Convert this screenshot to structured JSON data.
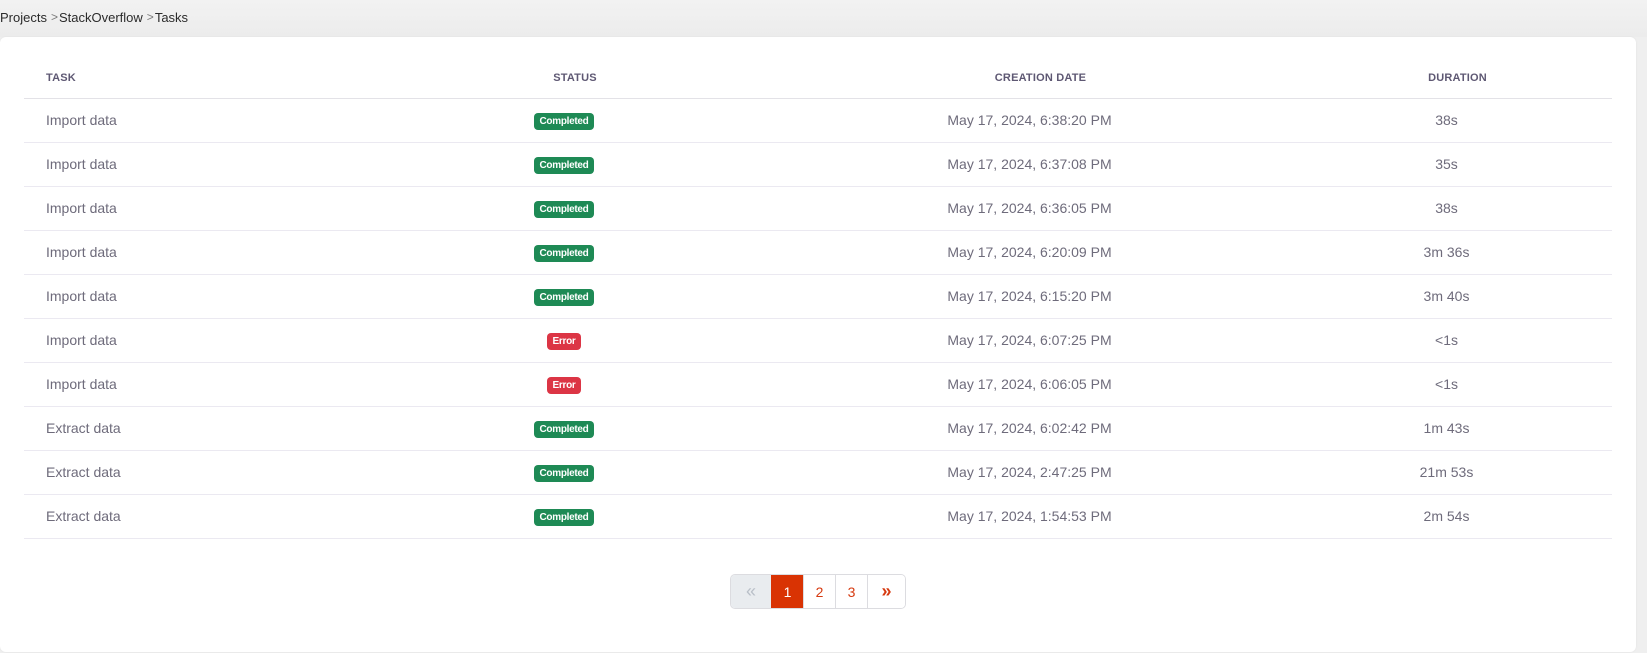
{
  "breadcrumb": {
    "items": [
      "Projects",
      "StackOverflow",
      "Tasks"
    ],
    "separator": ">"
  },
  "table": {
    "headers": {
      "task": "TASK",
      "status": "STATUS",
      "creation_date": "CREATION DATE",
      "duration": "DURATION"
    },
    "rows": [
      {
        "task": "Import data",
        "status": "Completed",
        "status_type": "completed",
        "creation_date": "May 17, 2024, 6:38:20 PM",
        "duration": "38s"
      },
      {
        "task": "Import data",
        "status": "Completed",
        "status_type": "completed",
        "creation_date": "May 17, 2024, 6:37:08 PM",
        "duration": "35s"
      },
      {
        "task": "Import data",
        "status": "Completed",
        "status_type": "completed",
        "creation_date": "May 17, 2024, 6:36:05 PM",
        "duration": "38s"
      },
      {
        "task": "Import data",
        "status": "Completed",
        "status_type": "completed",
        "creation_date": "May 17, 2024, 6:20:09 PM",
        "duration": "3m 36s"
      },
      {
        "task": "Import data",
        "status": "Completed",
        "status_type": "completed",
        "creation_date": "May 17, 2024, 6:15:20 PM",
        "duration": "3m 40s"
      },
      {
        "task": "Import data",
        "status": "Error",
        "status_type": "error",
        "creation_date": "May 17, 2024, 6:07:25 PM",
        "duration": "<1s"
      },
      {
        "task": "Import data",
        "status": "Error",
        "status_type": "error",
        "creation_date": "May 17, 2024, 6:06:05 PM",
        "duration": "<1s"
      },
      {
        "task": "Extract data",
        "status": "Completed",
        "status_type": "completed",
        "creation_date": "May 17, 2024, 6:02:42 PM",
        "duration": "1m 43s"
      },
      {
        "task": "Extract data",
        "status": "Completed",
        "status_type": "completed",
        "creation_date": "May 17, 2024, 2:47:25 PM",
        "duration": "21m 53s"
      },
      {
        "task": "Extract data",
        "status": "Completed",
        "status_type": "completed",
        "creation_date": "May 17, 2024, 1:54:53 PM",
        "duration": "2m 54s"
      }
    ]
  },
  "pagination": {
    "first_icon": "«",
    "last_icon": "»",
    "pages": [
      "1",
      "2",
      "3"
    ],
    "current_page": "1"
  },
  "colors": {
    "accent": "#d93303",
    "completed": "#1e8a55",
    "error": "#dc3545"
  }
}
